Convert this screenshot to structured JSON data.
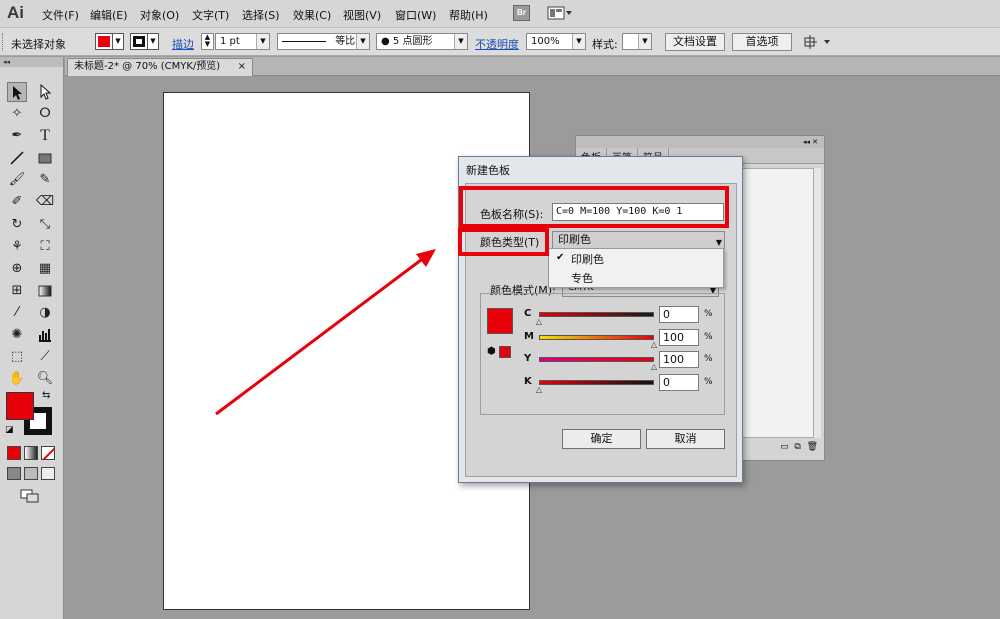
{
  "app": {
    "logo": "Ai"
  },
  "menu": [
    "文件(F)",
    "编辑(E)",
    "对象(O)",
    "文字(T)",
    "选择(S)",
    "效果(C)",
    "视图(V)",
    "窗口(W)",
    "帮助(H)"
  ],
  "menu_extra": {
    "bridge": "Br"
  },
  "controlbar": {
    "selection_status": "未选择对象",
    "stroke_link": "描边",
    "stroke_weight": "1 pt",
    "stroke_profile": "等比",
    "brush": "● 5 点圆形",
    "opacity_link": "不透明度",
    "opacity_value": "100%",
    "style_label": "样式:",
    "doc_settings": "文档设置",
    "preferences": "首选项",
    "fill_color": "#e8000a"
  },
  "document": {
    "tab_title": "未标题-2* @ 70% (CMYK/预览)",
    "close": "×"
  },
  "swatches_panel": {
    "tabs": [
      "色板",
      "画笔",
      "符号"
    ],
    "colors": [
      "#ffffff",
      "#ffff00",
      "#fcd116",
      "#f9a11b",
      "#f5811f",
      "#e8000a",
      "#ed1c24",
      "#ee2a7b",
      "#ec008c",
      "#c2185b",
      "#e6e6e6",
      "#8dc63f",
      "#00a651",
      "#00aeef",
      "#0072bc",
      "#2e3192",
      "#662d91",
      "#92278f",
      "#ed145b",
      "#f26522",
      "#cccccc",
      "#a67c52",
      "#8c6239",
      "#754c24",
      "#603913",
      "#c69c6d",
      "#998675",
      "#736357",
      "#534741",
      "#362f2d"
    ]
  },
  "dialog": {
    "title": "新建色板",
    "name_label": "色板名称(S):",
    "name_value": "C=0 M=100 Y=100 K=0 1",
    "type_label": "颜色类型(T)",
    "type_value": "印刷色",
    "type_options": [
      "印刷色",
      "专色"
    ],
    "selected_option_check": "✔",
    "mode_label": "颜色模式(M):",
    "mode_value": "CMYK",
    "swatch_color": "#e8000a",
    "channels": [
      {
        "label": "C",
        "value": "0",
        "fraction": 0.0
      },
      {
        "label": "M",
        "value": "100",
        "fraction": 1.0
      },
      {
        "label": "Y",
        "value": "100",
        "fraction": 1.0
      },
      {
        "label": "K",
        "value": "0",
        "fraction": 0.0
      }
    ],
    "percent": "%",
    "ok": "确定",
    "cancel": "取消"
  },
  "annotation": {
    "color": "#e8000a"
  }
}
